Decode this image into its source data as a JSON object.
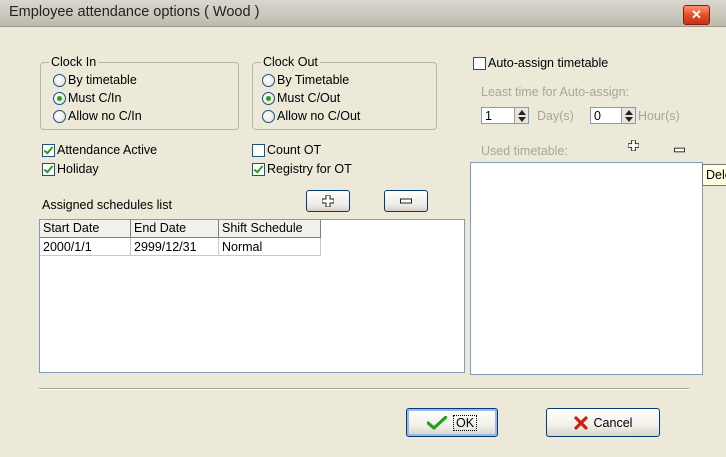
{
  "window": {
    "title": "Employee attendance options ( Wood )",
    "close_glyph": "✕"
  },
  "clock_in": {
    "title": "Clock In",
    "options": [
      "By timetable",
      "Must C/In",
      "Allow no C/In"
    ],
    "selected": "Must C/In"
  },
  "clock_out": {
    "title": "Clock Out",
    "options": [
      "By Timetable",
      "Must C/Out",
      "Allow no C/Out"
    ],
    "selected": "Must C/Out"
  },
  "checks": {
    "attendance_active": {
      "label": "Attendance Active",
      "checked": true
    },
    "holiday": {
      "label": "Holiday",
      "checked": true
    },
    "count_ot": {
      "label": "Count OT",
      "checked": false
    },
    "registry_ot": {
      "label": "Registry for OT",
      "checked": true
    },
    "auto_assign": {
      "label": "Auto-assign timetable",
      "checked": false
    }
  },
  "schedules": {
    "title": "Assigned schedules list",
    "columns": [
      "Start Date",
      "End Date",
      "Shift Schedule"
    ],
    "rows": [
      [
        "2000/1/1",
        "2999/12/31",
        "Normal"
      ]
    ]
  },
  "auto_assign_panel": {
    "least_time_label": "Least time for Auto-assign:",
    "days_value": "1",
    "days_unit": "Day(s)",
    "hours_value": "0",
    "hours_unit": "Hour(s)",
    "used_timetable_label": "Used timetable:"
  },
  "tooltip": {
    "text": "Delete"
  },
  "icons": {
    "add": "plus-icon",
    "remove": "minus-icon",
    "ok": "checkmark-icon",
    "cancel": "x-mark-icon"
  },
  "colors": {
    "check_green": "#21a121",
    "cancel_red": "#cc1f10",
    "close_red": "#de4b27"
  },
  "buttons": {
    "ok": "OK",
    "cancel": "Cancel"
  }
}
